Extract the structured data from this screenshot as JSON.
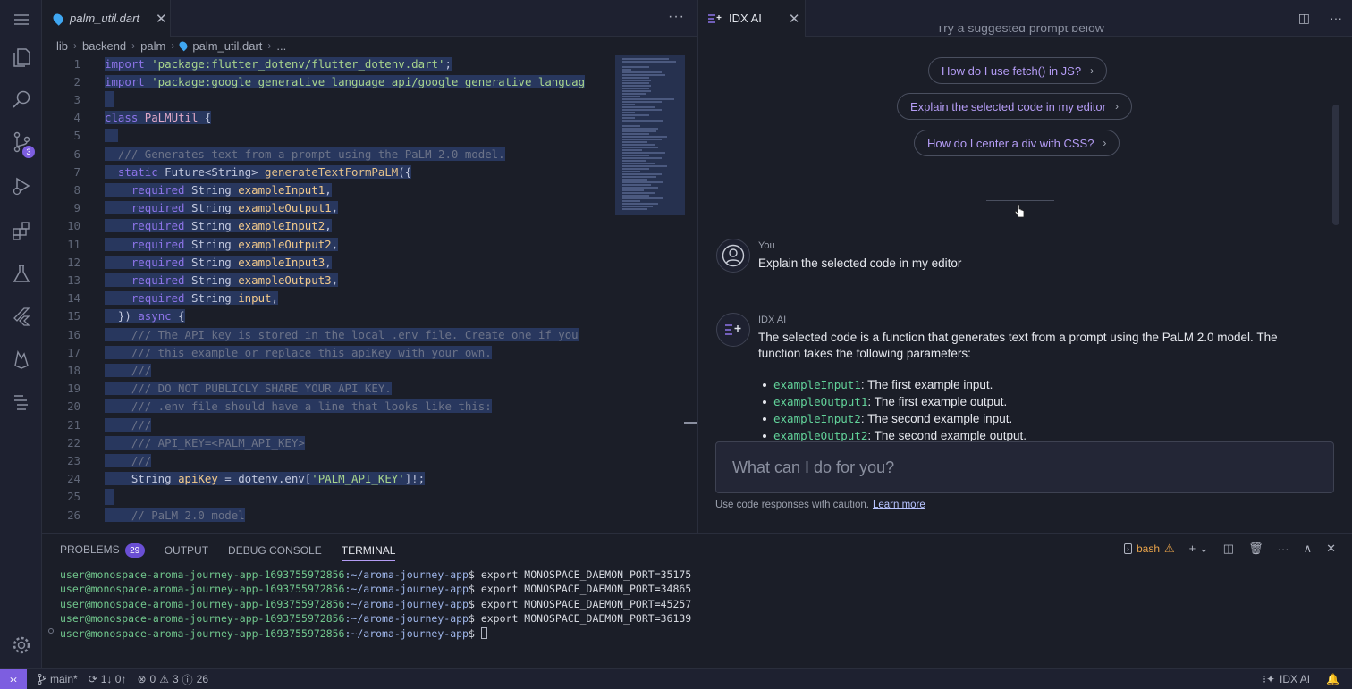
{
  "activity_bar": {
    "icons": [
      "menu-icon",
      "files-icon",
      "search-icon",
      "source-control-icon",
      "run-debug-icon",
      "extensions-icon",
      "testing-icon",
      "flutter-icon",
      "firebase-icon",
      "outline-icon",
      "settings-icon"
    ],
    "scm_badge": "3"
  },
  "editor": {
    "tab_name": "palm_util.dart",
    "breadcrumb": [
      "lib",
      "backend",
      "palm",
      "palm_util.dart",
      "..."
    ],
    "line_numbers": [
      "1",
      "2",
      "3",
      "4",
      "5",
      "6",
      "7",
      "8",
      "9",
      "10",
      "11",
      "12",
      "13",
      "14",
      "15",
      "16",
      "17",
      "18",
      "19",
      "20",
      "21",
      "22",
      "23",
      "24",
      "25",
      "26"
    ],
    "lines": [
      [
        [
          "kw",
          "import "
        ],
        [
          "str",
          "'package:flutter_dotenv/flutter_dotenv.dart'"
        ],
        [
          "ty",
          ";"
        ]
      ],
      [
        [
          "kw",
          "import "
        ],
        [
          "str",
          "'package:google_generative_language_api/google_generative_languag"
        ]
      ],
      [],
      [
        [
          "kw",
          "class "
        ],
        [
          "cls",
          "PaLMUtil"
        ],
        [
          "ty",
          " {"
        ]
      ],
      [
        [
          "cm",
          "  "
        ]
      ],
      [
        [
          "cm",
          "  /// Generates text from a prompt using the PaLM 2.0 model."
        ]
      ],
      [
        [
          "kw",
          "  static "
        ],
        [
          "ty",
          "Future<String> "
        ],
        [
          "fn",
          "generateTextFormPaLM"
        ],
        [
          "ty",
          "({"
        ]
      ],
      [
        [
          "kw",
          "    required "
        ],
        [
          "ty",
          "String "
        ],
        [
          "var",
          "exampleInput1"
        ],
        [
          "ty",
          ","
        ]
      ],
      [
        [
          "kw",
          "    required "
        ],
        [
          "ty",
          "String "
        ],
        [
          "var",
          "exampleOutput1"
        ],
        [
          "ty",
          ","
        ]
      ],
      [
        [
          "kw",
          "    required "
        ],
        [
          "ty",
          "String "
        ],
        [
          "var",
          "exampleInput2"
        ],
        [
          "ty",
          ","
        ]
      ],
      [
        [
          "kw",
          "    required "
        ],
        [
          "ty",
          "String "
        ],
        [
          "var",
          "exampleOutput2"
        ],
        [
          "ty",
          ","
        ]
      ],
      [
        [
          "kw",
          "    required "
        ],
        [
          "ty",
          "String "
        ],
        [
          "var",
          "exampleInput3"
        ],
        [
          "ty",
          ","
        ]
      ],
      [
        [
          "kw",
          "    required "
        ],
        [
          "ty",
          "String "
        ],
        [
          "var",
          "exampleOutput3"
        ],
        [
          "ty",
          ","
        ]
      ],
      [
        [
          "kw",
          "    required "
        ],
        [
          "ty",
          "String "
        ],
        [
          "var",
          "input"
        ],
        [
          "ty",
          ","
        ]
      ],
      [
        [
          "ty",
          "  }) "
        ],
        [
          "kw",
          "async"
        ],
        [
          "ty",
          " {"
        ]
      ],
      [
        [
          "cm",
          "    /// The API key is stored in the local .env file. Create one if you"
        ]
      ],
      [
        [
          "cm",
          "    /// this example or replace this apiKey with your own."
        ]
      ],
      [
        [
          "cm",
          "    ///"
        ]
      ],
      [
        [
          "cm",
          "    /// DO NOT PUBLICLY SHARE YOUR API KEY."
        ]
      ],
      [
        [
          "cm",
          "    /// .env file should have a line that looks like this:"
        ]
      ],
      [
        [
          "cm",
          "    ///"
        ]
      ],
      [
        [
          "cm",
          "    /// API_KEY=<PALM_API_KEY>"
        ]
      ],
      [
        [
          "cm",
          "    ///"
        ]
      ],
      [
        [
          "ty",
          "    String "
        ],
        [
          "var",
          "apiKey"
        ],
        [
          "ty",
          " = dotenv.env["
        ],
        [
          "str",
          "'PALM_API_KEY'"
        ],
        [
          "ty",
          "]!;"
        ]
      ],
      [],
      [
        [
          "cm",
          "    // PaLM 2.0 model"
        ]
      ]
    ]
  },
  "panel": {
    "tab_name": "IDX AI",
    "suggested_heading": "Try a suggested prompt below",
    "suggestions": [
      "How do I use fetch() in JS?",
      "Explain the selected code in my editor",
      "How do I center a div with CSS?"
    ],
    "user_name": "You",
    "user_message": "Explain the selected code in my editor",
    "ai_name": "IDX AI",
    "ai_message": "The selected code is a function that generates text from a prompt using the PaLM 2.0 model. The function takes the following parameters:",
    "params": [
      {
        "code": "exampleInput1",
        "desc": ": The first example input."
      },
      {
        "code": "exampleOutput1",
        "desc": ": The first example output."
      },
      {
        "code": "exampleInput2",
        "desc": ": The second example input."
      },
      {
        "code": "exampleOutput2",
        "desc": ": The second example output."
      }
    ],
    "input_placeholder": "What can I do for you?",
    "caution_text": "Use code responses with caution.",
    "learn_more": "Learn more"
  },
  "bottom": {
    "tabs": [
      "PROBLEMS",
      "OUTPUT",
      "DEBUG CONSOLE",
      "TERMINAL"
    ],
    "problems_count": "29",
    "shell": "bash",
    "terminal_lines": [
      {
        "user": "user@monospace-aroma-journey-app-1693755972856",
        "path": ":~/aroma-journey-app",
        "cmd": "$ export MONOSPACE_DAEMON_PORT=35175"
      },
      {
        "user": "user@monospace-aroma-journey-app-1693755972856",
        "path": ":~/aroma-journey-app",
        "cmd": "$ export MONOSPACE_DAEMON_PORT=34865"
      },
      {
        "user": "user@monospace-aroma-journey-app-1693755972856",
        "path": ":~/aroma-journey-app",
        "cmd": "$ export MONOSPACE_DAEMON_PORT=45257"
      },
      {
        "user": "user@monospace-aroma-journey-app-1693755972856",
        "path": ":~/aroma-journey-app",
        "cmd": "$ export MONOSPACE_DAEMON_PORT=36139"
      },
      {
        "user": "user@monospace-aroma-journey-app-1693755972856",
        "path": ":~/aroma-journey-app",
        "cmd": "$ "
      }
    ]
  },
  "status": {
    "branch": "main*",
    "sync": "1↓ 0↑",
    "errors": "0",
    "warnings": "3",
    "infos": "26",
    "ai_label": "IDX AI"
  },
  "colors": {
    "accent": "#7d5ee0",
    "selection": "#28375e",
    "link": "#b49cf5"
  }
}
